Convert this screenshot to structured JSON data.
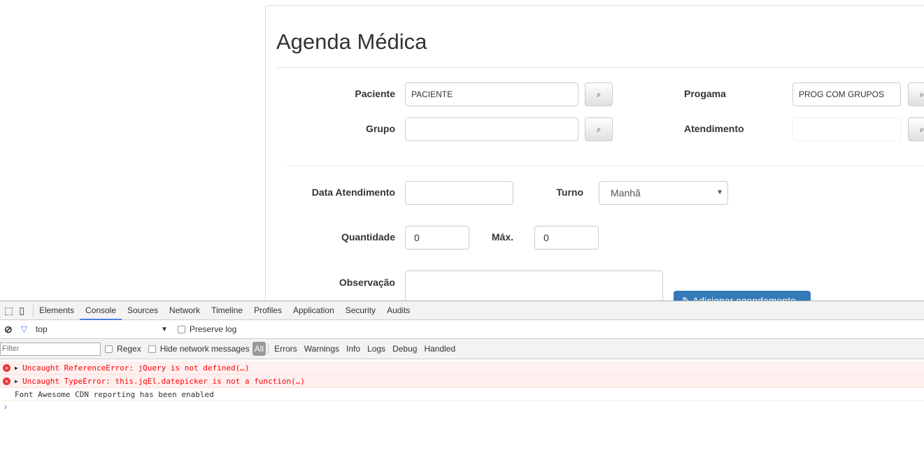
{
  "page": {
    "title": "Agenda Médica",
    "fields": {
      "paciente_label": "Paciente",
      "paciente_value": "PACIENTE",
      "grupo_label": "Grupo",
      "grupo_value": "",
      "programa_label": "Progama",
      "programa_value": "PROG COM GRUPOS",
      "atendimento_label": "Atendimento",
      "atendimento_value": "",
      "data_label": "Data Atendimento",
      "data_value": "",
      "turno_label": "Turno",
      "turno_value": "Manhã",
      "quantidade_label": "Quantidade",
      "quantidade_value": "0",
      "max_label": "Máx.",
      "max_value": "0",
      "observacao_label": "Observação"
    },
    "primary_button": "Adicionar agendamento"
  },
  "devtools": {
    "tabs": [
      "Elements",
      "Console",
      "Sources",
      "Network",
      "Timeline",
      "Profiles",
      "Application",
      "Security",
      "Audits"
    ],
    "active_tab": "Console",
    "context": "top",
    "preserve_log": "Preserve log",
    "filter_placeholder": "Filter",
    "regex": "Regex",
    "hide_network": "Hide network messages",
    "levels": [
      "All",
      "Errors",
      "Warnings",
      "Info",
      "Logs",
      "Debug",
      "Handled"
    ],
    "messages": [
      {
        "type": "error",
        "text": "Uncaught ReferenceError: jQuery is not defined(…)"
      },
      {
        "type": "error",
        "text": "Uncaught TypeError: this.jqEl.datepicker is not a function(…)"
      },
      {
        "type": "log",
        "text": "Font Awesome CDN reporting has been enabled"
      }
    ],
    "prompt": "›"
  },
  "colors": {
    "primary": "#337ab7",
    "error": "#ff0000",
    "error_bg": "#fff0f0"
  }
}
